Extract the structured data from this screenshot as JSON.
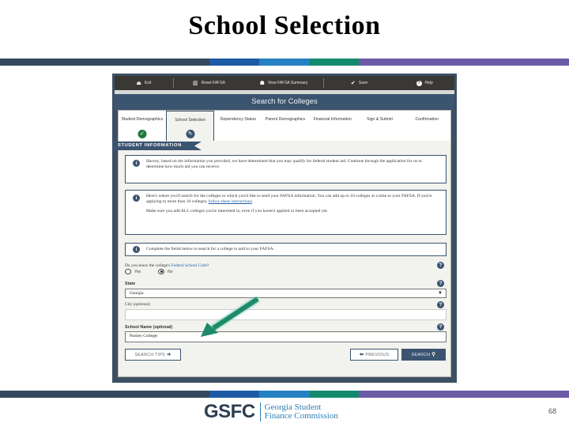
{
  "slide": {
    "title": "School Selection",
    "page_number": "68",
    "stripe_colors": [
      "#34495e",
      "#1d5aa6",
      "#2580c3",
      "#138a6c",
      "#6b5aa6"
    ]
  },
  "app": {
    "topnav": [
      {
        "icon": "exit-icon",
        "glyph": "⏏",
        "label": "Exit"
      },
      {
        "icon": "trash-icon",
        "glyph": "🗑",
        "label": "Reset FAFSA"
      },
      {
        "icon": "summary-icon",
        "glyph": "☗",
        "label": "View FAFSA Summary"
      },
      {
        "icon": "check-icon",
        "glyph": "✔",
        "label": "Save"
      },
      {
        "icon": "help-icon",
        "glyph": "?",
        "label": "Help"
      }
    ],
    "page_header": "Search for Colleges",
    "steps": [
      {
        "label": "Student Demographics",
        "status": "done",
        "glyph": "✓"
      },
      {
        "label": "School Selection",
        "status": "active",
        "glyph": "✎"
      },
      {
        "label": "Dependency Status"
      },
      {
        "label": "Parent Demographics"
      },
      {
        "label": "Financial Information"
      },
      {
        "label": "Sign & Submit"
      },
      {
        "label": "Confirmation"
      }
    ],
    "section_banner": "STUDENT INFORMATION",
    "alerts": {
      "eligibility": "Harvey, based on the information you provided, we have determined that you may qualify for federal student aid. Continue through the application for us to determine how much aid you can receive.",
      "search_p1": "Here's where you'll search for the colleges to which you'd like to send your FAFSA information. You can add up to 10 colleges at a time to your FAFSA. If you're applying to more than 10 colleges,",
      "search_link": "follow these instructions",
      "search_p2": "Make sure you add ALL colleges you're interested in, even if you haven't applied or been accepted yet.",
      "complete": "Complete the fields below to search for a college to add to your FAFSA."
    },
    "form": {
      "code_question_prefix": "Do you know the college's",
      "code_question_link": "Federal School Code",
      "code_question_suffix": "?",
      "radio_yes": "Yes",
      "radio_no": "No",
      "radio_selected": "No",
      "state_label": "State",
      "state_value": "Georgia",
      "city_label": "City (optional)",
      "city_value": "",
      "school_label": "School Name (optional)",
      "school_value": "Paisley College|"
    },
    "buttons": {
      "search_tips": "SEARCH TIPS",
      "previous": "PREVIOUS",
      "search": "SEARCH"
    }
  },
  "annotation": {
    "arrow_color": "#1f8a6a"
  },
  "footer": {
    "logo_abbr": "GSFC",
    "logo_line1": "Georgia Student",
    "logo_line2": "Finance Commission"
  }
}
